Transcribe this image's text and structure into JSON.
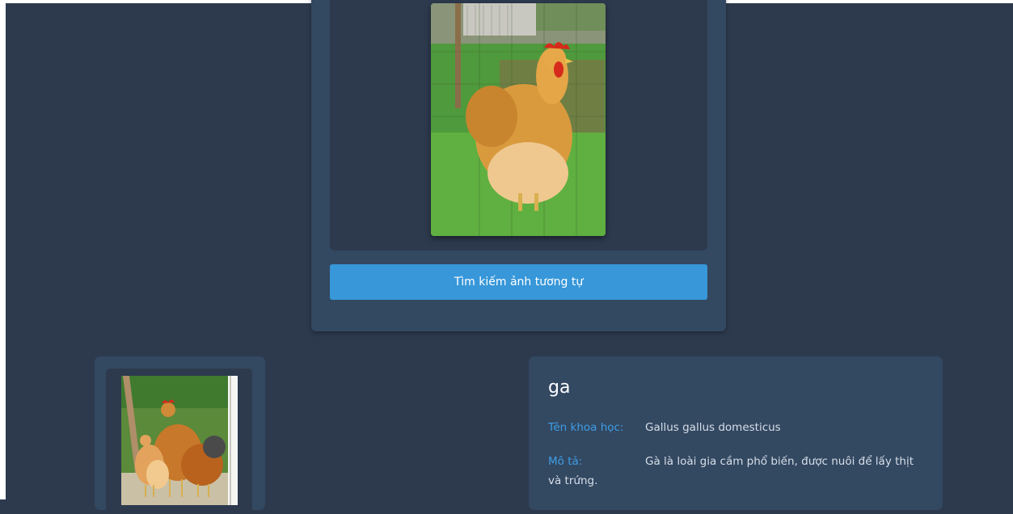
{
  "query": {
    "search_button_label": "Tìm kiếm ảnh tương tự"
  },
  "result": {
    "name": "ga",
    "scientific_name_label": "Tên khoa học:",
    "scientific_name": "Gallus gallus domesticus",
    "description_label": "Mô tả:",
    "description": "Gà là loài gia cầm phổ biến, được nuôi để lấy thịt và trứng."
  },
  "colors": {
    "background": "#2d3a4e",
    "card": "#334861",
    "accent": "#3797d9",
    "label": "#3d9ee6"
  },
  "icons": {
    "query_image": "rooster-photo",
    "result_image": "chickens-photo"
  }
}
